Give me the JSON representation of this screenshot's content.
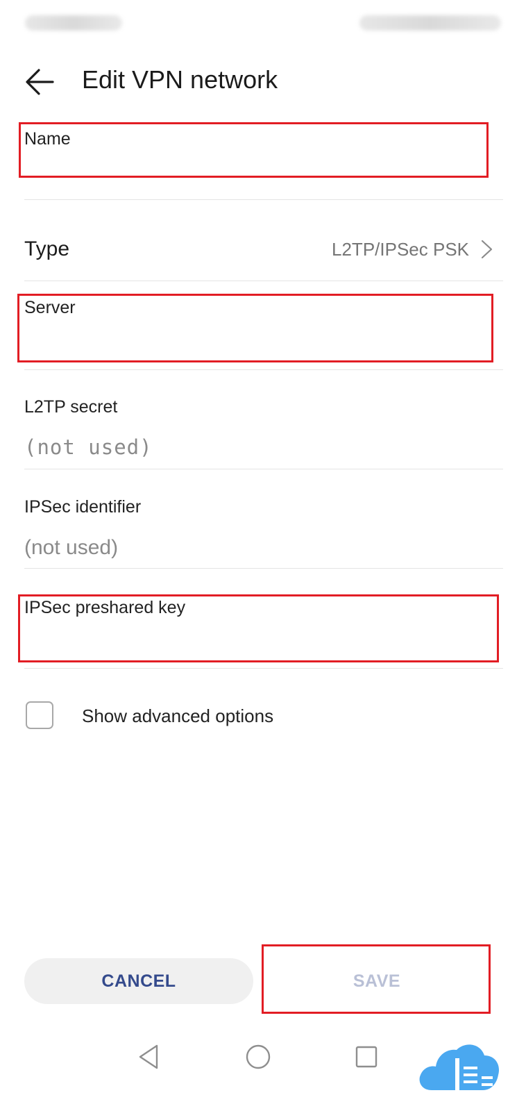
{
  "status_bar": {
    "left_text": "",
    "right_text": ""
  },
  "header": {
    "title": "Edit VPN network"
  },
  "form": {
    "name": {
      "label": "Name",
      "value": ""
    },
    "type": {
      "label": "Type",
      "value": "L2TP/IPSec PSK"
    },
    "server": {
      "label": "Server",
      "value": ""
    },
    "l2tp_secret": {
      "label": "L2TP secret",
      "placeholder": "(not used)"
    },
    "ipsec_identifier": {
      "label": "IPSec identifier",
      "placeholder": "(not used)"
    },
    "ipsec_psk": {
      "label": "IPSec preshared key",
      "value": ""
    },
    "advanced": {
      "label": "Show advanced options",
      "checked": false
    }
  },
  "actions": {
    "cancel_label": "CANCEL",
    "save_label": "SAVE"
  },
  "colors": {
    "highlight": "#e21d24",
    "cancel_text": "#344a8c",
    "save_text_disabled": "#b9c0d6",
    "watermark": "#4aa8f0"
  },
  "icons": {
    "back": "arrow-left-icon",
    "type_chevron": "chevron-right-icon",
    "nav_back": "triangle-back-icon",
    "nav_home": "circle-home-icon",
    "nav_recent": "square-recent-icon",
    "watermark": "cloud-logo-icon"
  }
}
